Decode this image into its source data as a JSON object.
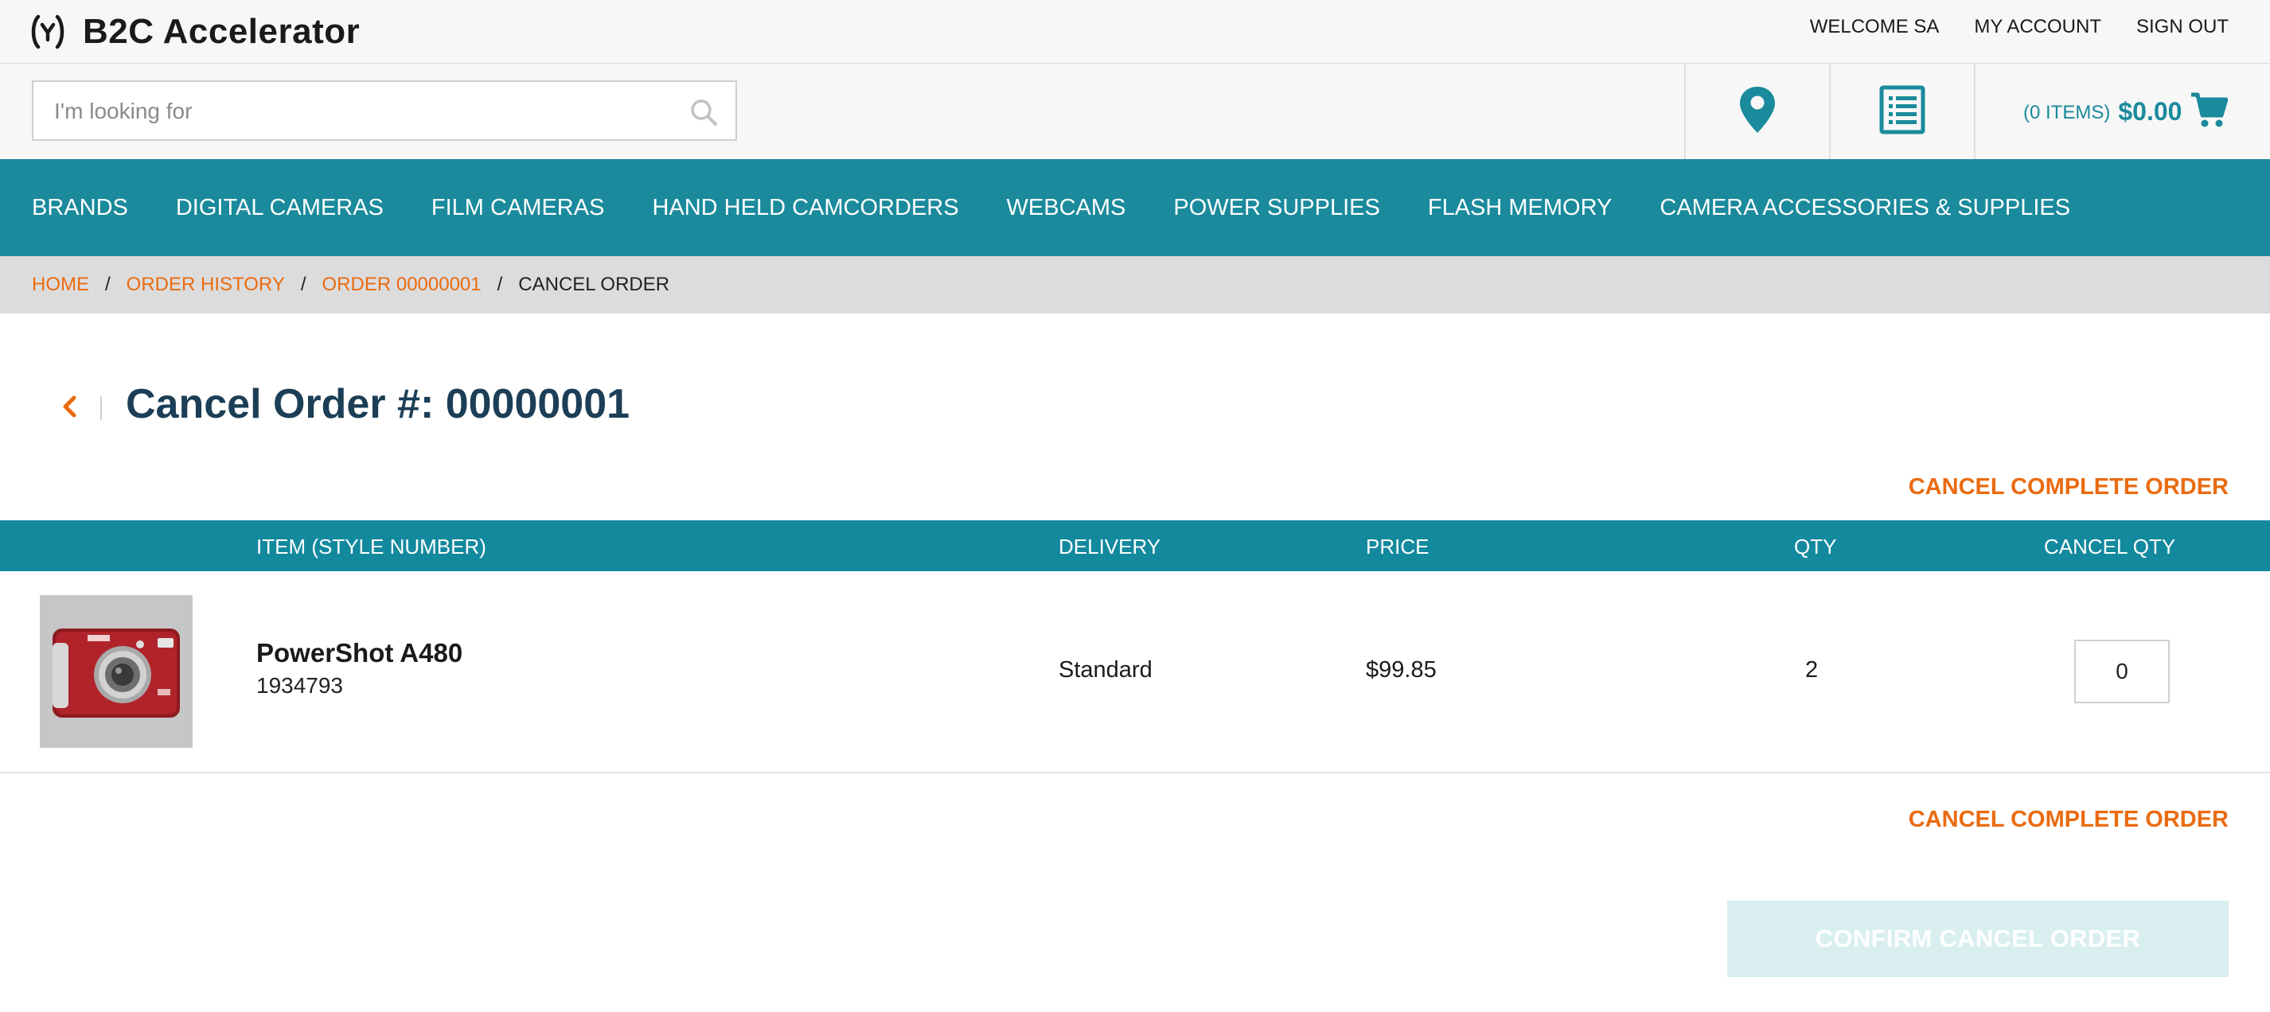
{
  "header": {
    "brand": "B2C Accelerator",
    "links": [
      "WELCOME SA",
      "MY ACCOUNT",
      "SIGN OUT"
    ]
  },
  "search": {
    "placeholder": "I'm looking for",
    "value": ""
  },
  "cart": {
    "items_label": "(0 ITEMS)",
    "total": "$0.00"
  },
  "nav": {
    "categories": [
      "BRANDS",
      "DIGITAL CAMERAS",
      "FILM CAMERAS",
      "HAND HELD CAMCORDERS",
      "WEBCAMS",
      "POWER SUPPLIES",
      "FLASH MEMORY",
      "CAMERA ACCESSORIES & SUPPLIES"
    ]
  },
  "breadcrumb": {
    "links": [
      "HOME",
      "ORDER HISTORY",
      "ORDER 00000001"
    ],
    "current": "CANCEL ORDER"
  },
  "page": {
    "title": "Cancel Order #: 00000001",
    "cancel_complete_label": "CANCEL COMPLETE ORDER",
    "confirm_label": "CONFIRM CANCEL ORDER"
  },
  "table": {
    "headers": {
      "item": "ITEM (STYLE NUMBER)",
      "delivery": "DELIVERY",
      "price": "PRICE",
      "qty": "QTY",
      "cancel_qty": "CANCEL QTY"
    },
    "rows": [
      {
        "name": "PowerShot A480",
        "code": "1934793",
        "delivery": "Standard",
        "price": "$99.85",
        "qty": "2",
        "cancel_qty": "0"
      }
    ]
  },
  "colors": {
    "teal": "#1a8a9c",
    "orange": "#ea6b10",
    "title_navy": "#1c3e56",
    "confirm_disabled": "#d9efef"
  },
  "icons": [
    "logo-mark-icon",
    "search-icon",
    "store-locator-icon",
    "quick-order-list-icon",
    "cart-icon",
    "chevron-left-icon"
  ]
}
